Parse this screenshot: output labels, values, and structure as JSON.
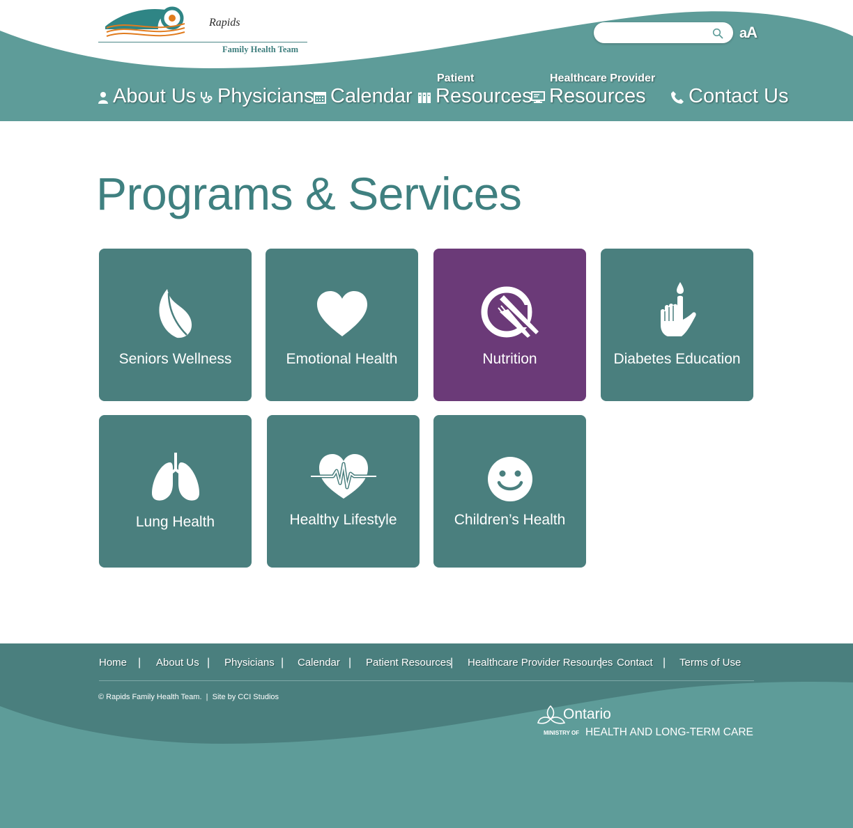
{
  "brand": {
    "name": "Rapids",
    "subtitle": "Family Health Team"
  },
  "search": {
    "placeholder": "",
    "value": ""
  },
  "text_size_toggle": {
    "small": "a",
    "large": "A"
  },
  "nav": {
    "about": {
      "label": "About Us",
      "icon": "person-icon"
    },
    "physicians": {
      "label": "Physicians",
      "icon": "stethoscope-icon"
    },
    "calendar": {
      "label": "Calendar",
      "icon": "calendar-icon"
    },
    "patient": {
      "prefix": "Patient",
      "label": "Resources",
      "icon": "books-icon"
    },
    "provider": {
      "prefix": "Healthcare Provider",
      "label": "Resources",
      "icon": "monitor-icon"
    },
    "contact": {
      "label": "Contact Us",
      "icon": "phone-icon"
    }
  },
  "page_title": "Programs & Services",
  "programs": [
    {
      "label": "Seniors Wellness",
      "icon": "leaf-icon",
      "active": false
    },
    {
      "label": "Emotional Health",
      "icon": "heart-icon",
      "active": false
    },
    {
      "label": "Nutrition",
      "icon": "plate-fork-knife-icon",
      "active": true
    },
    {
      "label": "Diabetes Education",
      "icon": "finger-drop-icon",
      "active": false
    },
    {
      "label": "Lung Health",
      "icon": "lungs-icon",
      "active": false
    },
    {
      "label": "Healthy Lifestyle",
      "icon": "heartbeat-icon",
      "active": false
    },
    {
      "label": "Children’s Health",
      "icon": "smiley-icon",
      "active": false
    }
  ],
  "footer": {
    "links": [
      "Home",
      "About Us",
      "Physicians",
      "Calendar",
      "Patient Resources",
      "Healthcare Provider Resources",
      "Contact",
      "Terms of Use"
    ],
    "separator": "|",
    "copyright": "© Rapids Family Health Team.",
    "credit_sep": "|",
    "credit": "Site by CCI Studios",
    "ontario": {
      "name": "Ontario",
      "ministry_of": "MINISTRY OF",
      "ministry": "HEALTH AND LONG-TERM CARE"
    }
  },
  "colors": {
    "teal": "#5e9c99",
    "teal_dark": "#4a7f7e",
    "title_teal": "#3f8080",
    "purple": "#6b3a78",
    "logo_orange": "#e07b1e"
  }
}
